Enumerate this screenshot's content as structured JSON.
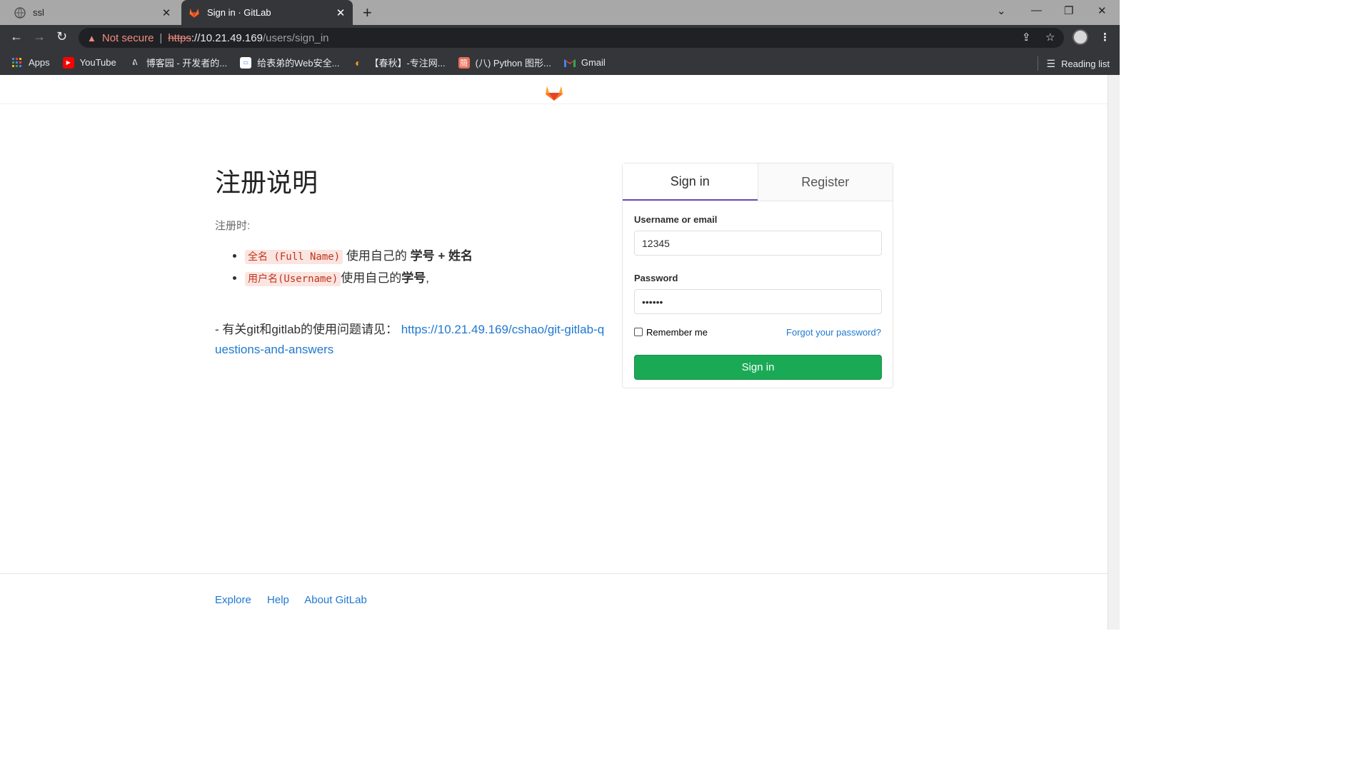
{
  "browser": {
    "tabs": [
      {
        "title": "ssl",
        "icon": "globe-icon"
      },
      {
        "title": "Sign in · GitLab",
        "icon": "gitlab-icon"
      }
    ],
    "url": {
      "security_text": "Not secure",
      "scheme": "https",
      "host": "://10.21.49.169",
      "path": "/users/sign_in"
    },
    "bookmarks": [
      {
        "label": "Apps",
        "icon": "apps-icon"
      },
      {
        "label": "YouTube",
        "icon": "youtube-icon"
      },
      {
        "label": "博客园 - 开发者的...",
        "icon": "cnblogs-icon"
      },
      {
        "label": "给表弟的Web安全...",
        "icon": "page-icon"
      },
      {
        "label": "【春秋】-专注网...",
        "icon": "ichunqiu-icon"
      },
      {
        "label": "(八) Python 图形...",
        "icon": "jianshu-icon"
      },
      {
        "label": "Gmail",
        "icon": "gmail-icon"
      }
    ],
    "reading_list": "Reading list"
  },
  "info": {
    "title": "注册说明",
    "subtitle": "注册时:",
    "items": [
      {
        "code": "全名 (Full Name)",
        "text": " 使用自己的 ",
        "bold": "学号 + 姓名",
        "suffix": ""
      },
      {
        "code": "用户名(Username)",
        "text": "使用自己的",
        "bold": "学号",
        "suffix": ","
      }
    ],
    "help_prefix": "- 有关git和gitlab的使用问题请见：",
    "help_link": "https://10.21.49.169/cshao/git-gitlab-questions-and-answers"
  },
  "login": {
    "tab_signin": "Sign in",
    "tab_register": "Register",
    "username_label": "Username or email",
    "username_value": "12345",
    "password_label": "Password",
    "password_value": "••••••",
    "remember_label": "Remember me",
    "forgot_label": "Forgot your password?",
    "submit_label": "Sign in"
  },
  "footer": {
    "links": [
      "Explore",
      "Help",
      "About GitLab"
    ]
  },
  "colors": {
    "accent": "#1aaa55",
    "link": "#1f78d1",
    "tab_underline": "#6b4fbb"
  }
}
